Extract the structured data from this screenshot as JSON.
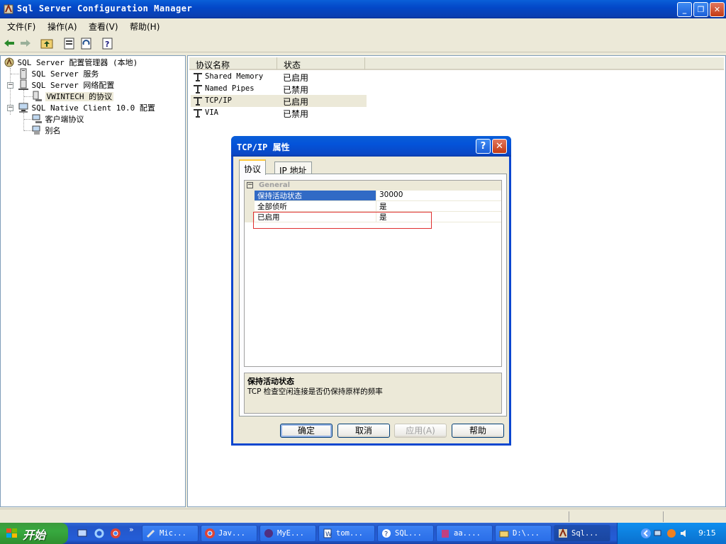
{
  "window": {
    "title": "Sql Server Configuration Manager",
    "buttons": {
      "minimize": "_",
      "restore": "❐",
      "close": "✕"
    }
  },
  "menu": [
    "文件(F)",
    "操作(A)",
    "查看(V)",
    "帮助(H)"
  ],
  "tree": {
    "root": "SQL Server 配置管理器 (本地)",
    "services": "SQL Server 服务",
    "network": "SQL Server 网络配置",
    "instance_protocols": "VWINTECH 的协议",
    "native_client": "SQL Native Client 10.0 配置",
    "client_protocols": "客户端协议",
    "aliases": "别名",
    "expander_minus": "−"
  },
  "list": {
    "columns": [
      "协议名称",
      "状态"
    ],
    "rows": [
      {
        "name": "Shared Memory",
        "status": "已启用"
      },
      {
        "name": "Named Pipes",
        "status": "已禁用"
      },
      {
        "name": "TCP/IP",
        "status": "已启用"
      },
      {
        "name": "VIA",
        "status": "已禁用"
      }
    ]
  },
  "dialog": {
    "title": "TCP/IP 属性",
    "help_button": "?",
    "close_button": "✕",
    "tabs": [
      "协议",
      "IP 地址"
    ],
    "category": "General",
    "category_expander": "−",
    "properties": [
      {
        "name": "保持活动状态",
        "value": "30000"
      },
      {
        "name": "全部侦听",
        "value": "是"
      },
      {
        "name": "已启用",
        "value": "是"
      }
    ],
    "description_title": "保持活动状态",
    "description_text": "TCP 检查空闲连接是否仍保持原样的频率",
    "buttons": {
      "ok": "确定",
      "cancel": "取消",
      "apply": "应用(A)",
      "help": "帮助"
    }
  },
  "taskbar": {
    "start": "开始",
    "chevron": "»",
    "tasks": [
      "Mic...",
      "Jav...",
      "MyE...",
      "tom...",
      "SQL...",
      "aa....",
      "D:\\...",
      "Sql..."
    ],
    "clock": "9:15"
  },
  "colors": {
    "title_blue": "#0348c8",
    "selection_blue": "#316ac5",
    "highlight_red": "#e03030",
    "start_green": "#37a93f"
  }
}
